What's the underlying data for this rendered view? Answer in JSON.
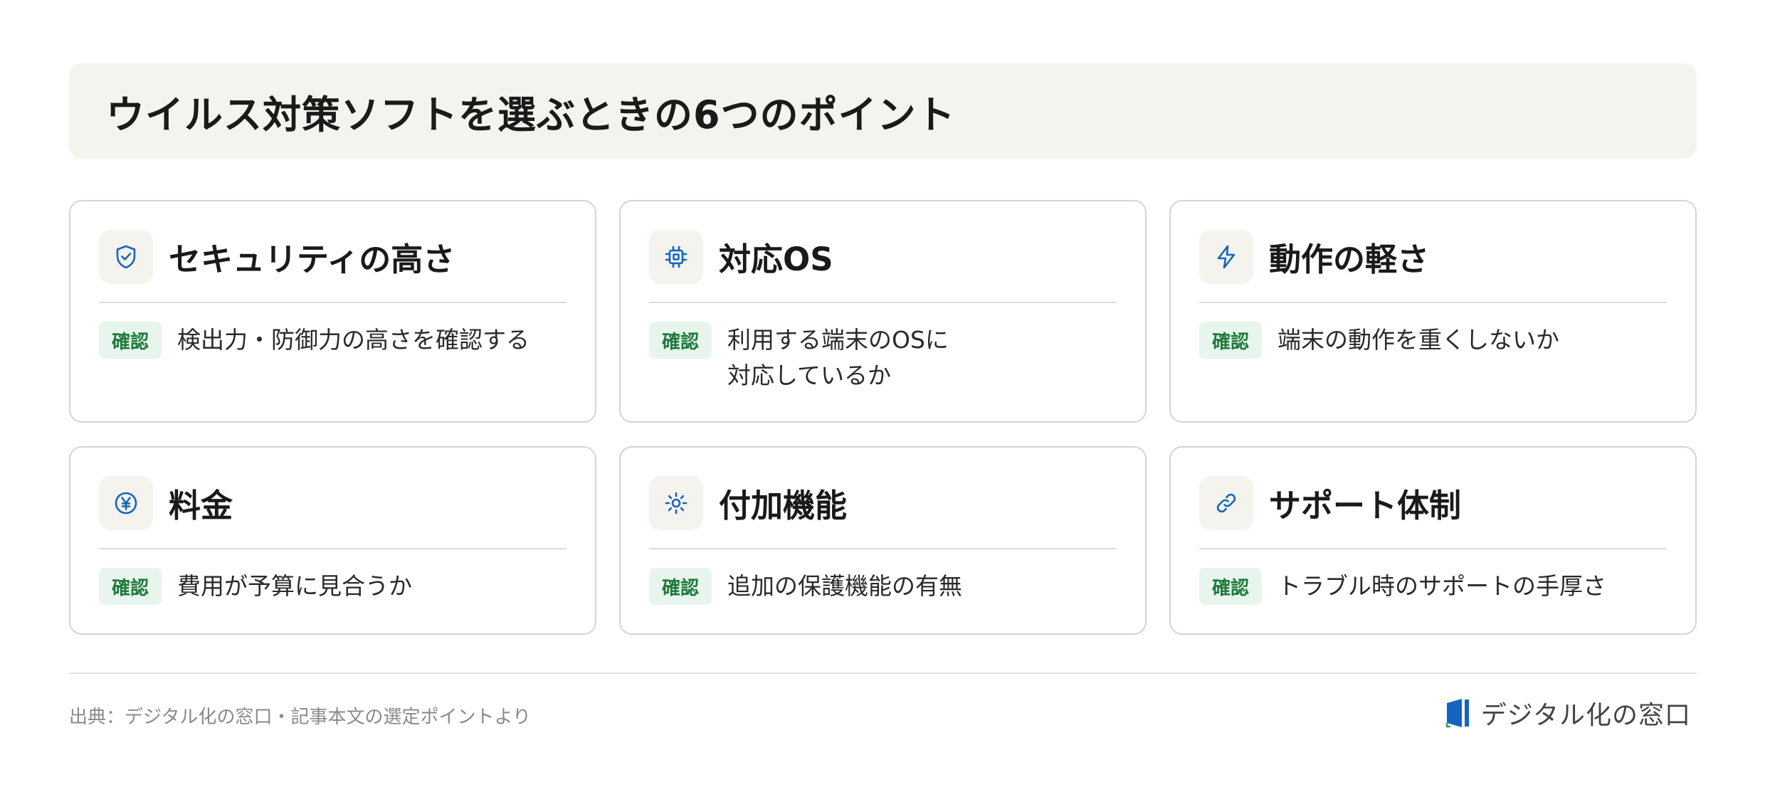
{
  "header": {
    "title": "ウイルス対策ソフトを選ぶときの6つのポイント"
  },
  "badge_label": "確認",
  "cards": [
    {
      "icon": "shield-check-icon",
      "title": "セキュリティの高さ",
      "desc_lines": [
        "検出力・防御力の高さを確認する"
      ]
    },
    {
      "icon": "chip-icon",
      "title": "対応OS",
      "desc_lines": [
        "利用する端末のOSに",
        "対応しているか"
      ]
    },
    {
      "icon": "lightning-icon",
      "title": "動作の軽さ",
      "desc_lines": [
        "端末の動作を重くしないか"
      ]
    },
    {
      "icon": "yen-coin-icon",
      "title": "料金",
      "desc_lines": [
        "費用が予算に見合うか"
      ]
    },
    {
      "icon": "sun-icon",
      "title": "付加機能",
      "desc_lines": [
        "追加の保護機能の有無"
      ]
    },
    {
      "icon": "link-icon",
      "title": "サポート体制",
      "desc_lines": [
        "トラブル時のサポートの手厚さ"
      ]
    }
  ],
  "footer": {
    "source": "出典：デジタル化の窓口・記事本文の選定ポイントより",
    "brand_name": "デジタル化の窓口"
  },
  "colors": {
    "icon_blue": "#1565c0",
    "badge_text": "#1f7a3d",
    "badge_bg": "#e8f5ec",
    "banner_bg": "#f5f3ee"
  }
}
